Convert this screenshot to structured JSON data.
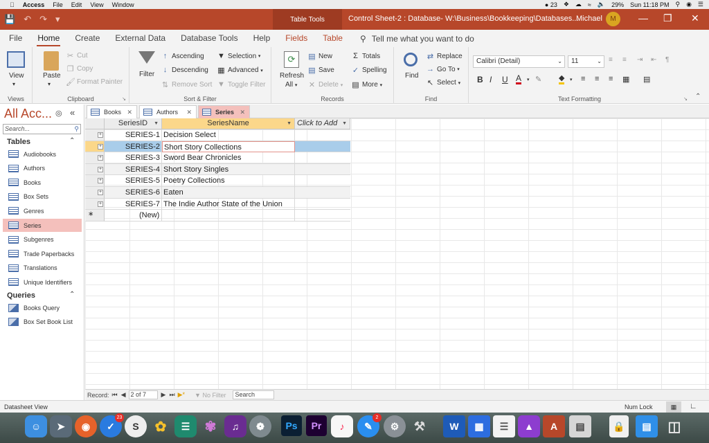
{
  "mac_menubar": {
    "app": "Access",
    "menus": [
      "File",
      "Edit",
      "View",
      "Window"
    ],
    "status_items": [
      "23",
      "29%",
      "Sun 11:18 PM"
    ]
  },
  "titlebar": {
    "context_tab": "Table Tools",
    "doc_title": "Control Sheet-2 : Database- W:\\Business\\Bookkeeping\\Databases...",
    "user": "Michael",
    "avatar_letter": "M"
  },
  "ribbon_tabs": [
    "File",
    "Home",
    "Create",
    "External Data",
    "Database Tools",
    "Help",
    "Fields",
    "Table"
  ],
  "tellme": "Tell me what you want to do",
  "ribbon": {
    "views": {
      "view": "View",
      "label": "Views"
    },
    "clipboard": {
      "paste": "Paste",
      "cut": "Cut",
      "copy": "Copy",
      "format_painter": "Format Painter",
      "label": "Clipboard"
    },
    "sort_filter": {
      "filter": "Filter",
      "ascending": "Ascending",
      "descending": "Descending",
      "remove_sort": "Remove Sort",
      "selection": "Selection",
      "advanced": "Advanced",
      "toggle_filter": "Toggle Filter",
      "label": "Sort & Filter"
    },
    "records": {
      "refresh": "Refresh",
      "refresh_all": "All",
      "new": "New",
      "save": "Save",
      "delete": "Delete",
      "totals": "Totals",
      "spelling": "Spelling",
      "more": "More",
      "label": "Records"
    },
    "find": {
      "find": "Find",
      "replace": "Replace",
      "goto": "Go To",
      "select": "Select",
      "label": "Find"
    },
    "text_formatting": {
      "font": "Calibri (Detail)",
      "size": "11",
      "label": "Text Formatting"
    }
  },
  "nav": {
    "title": "All Acc...",
    "search_placeholder": "Search...",
    "sections": {
      "tables": "Tables",
      "queries": "Queries"
    },
    "tables": [
      "Audiobooks",
      "Authors",
      "Books",
      "Box Sets",
      "Genres",
      "Series",
      "Subgenres",
      "Trade Paperbacks",
      "Translations",
      "Unique Identifiers"
    ],
    "queries": [
      "Books Query",
      "Box Set Book List"
    ],
    "selected": "Series"
  },
  "doc_tabs": [
    "Books",
    "Authors",
    "Series"
  ],
  "active_doc_tab": "Series",
  "datasheet": {
    "columns": [
      "SeriesID",
      "SeriesName",
      "Click to Add"
    ],
    "rows": [
      [
        "SERIES-1",
        "Decision Select"
      ],
      [
        "SERIES-2",
        "Short Story Collections"
      ],
      [
        "SERIES-3",
        "Sword Bear Chronicles"
      ],
      [
        "SERIES-4",
        "Short Story Singles"
      ],
      [
        "SERIES-5",
        "Poetry Collections"
      ],
      [
        "SERIES-6",
        "Eaten"
      ],
      [
        "SERIES-7",
        "The Indie Author State of the Union"
      ]
    ],
    "new_row": "(New)",
    "current_row_index": 1
  },
  "record_nav": {
    "label": "Record:",
    "position": "2 of 7",
    "filter": "No Filter",
    "search": "Search"
  },
  "statusbar": {
    "left": "Datasheet View",
    "right": "Num Lock"
  },
  "dock": {
    "badges": {
      "mail": "23",
      "messages": "2"
    }
  }
}
